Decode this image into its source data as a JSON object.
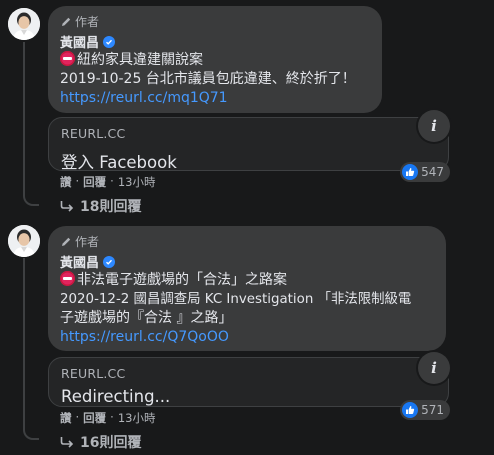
{
  "comments": [
    {
      "author_badge": "作者",
      "author_name": "黃國昌",
      "line1": "紐約家具違建關說案",
      "line2": "2019-10-25 台北市議員包庇違建、終於折了！",
      "line3": "",
      "link": "https://reurl.cc/mq1Q71",
      "preview_domain": "REURL.CC",
      "preview_title": "登入 Facebook",
      "info_label": "i",
      "actions": {
        "like": "讚",
        "sep": "·",
        "reply": "回覆",
        "time": "13小時"
      },
      "reactions_count": "547",
      "replies_label": "18則回覆"
    },
    {
      "author_badge": "作者",
      "author_name": "黃國昌",
      "line1": "非法電子遊戲場的「合法」之路案",
      "line2": "2020-12-2 國昌調查局 KC Investigation 「非法限制級電",
      "line3": "子遊戲場的『合法 』之路」",
      "link": "https://reurl.cc/Q7QoOO",
      "preview_domain": "REURL.CC",
      "preview_title": "Redirecting...",
      "info_label": "i",
      "actions": {
        "like": "讚",
        "sep": "·",
        "reply": "回覆",
        "time": "13小時"
      },
      "reactions_count": "571",
      "replies_label": "16則回覆"
    }
  ],
  "icons": {
    "reply_arrow": "reply-arrow-icon",
    "like": "like-icon",
    "verified": "verified-badge-icon",
    "pencil": "pencil-icon",
    "info": "info-icon",
    "no_entry": "no-entry-icon"
  },
  "colors": {
    "background": "#18191a",
    "bubble": "#3a3b3c",
    "link": "#4599ff",
    "like": "#1877f2"
  }
}
